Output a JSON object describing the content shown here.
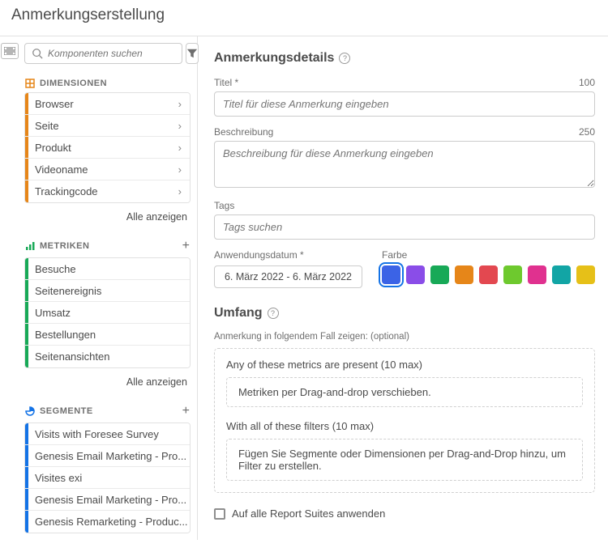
{
  "title": "Anmerkungserstellung",
  "search": {
    "placeholder": "Komponenten suchen"
  },
  "dimensions": {
    "heading": "DIMENSIONEN",
    "show_all": "Alle anzeigen",
    "items": [
      {
        "label": "Browser"
      },
      {
        "label": "Seite"
      },
      {
        "label": "Produkt"
      },
      {
        "label": "Videoname"
      },
      {
        "label": "Trackingcode"
      }
    ]
  },
  "metrics": {
    "heading": "METRIKEN",
    "show_all": "Alle anzeigen",
    "items": [
      {
        "label": "Besuche"
      },
      {
        "label": "Seitenereignis"
      },
      {
        "label": "Umsatz"
      },
      {
        "label": "Bestellungen"
      },
      {
        "label": "Seitenansichten"
      }
    ]
  },
  "segments": {
    "heading": "SEGMENTE",
    "items": [
      {
        "label": "Visits with Foresee Survey"
      },
      {
        "label": "Genesis Email Marketing - Pro..."
      },
      {
        "label": "Visites exi"
      },
      {
        "label": "Genesis Email Marketing - Pro..."
      },
      {
        "label": "Genesis Remarketing - Produc..."
      }
    ]
  },
  "details": {
    "heading": "Anmerkungsdetails",
    "title_label": "Titel *",
    "title_max": "100",
    "title_placeholder": "Titel für diese Anmerkung eingeben",
    "desc_label": "Beschreibung",
    "desc_max": "250",
    "desc_placeholder": "Beschreibung für diese Anmerkung eingeben",
    "tags_label": "Tags",
    "tags_placeholder": "Tags suchen",
    "date_label": "Anwendungsdatum *",
    "date_value": "6. März 2022 - 6. März 2022",
    "color_label": "Farbe",
    "colors": [
      "#3b63e6",
      "#8a4de8",
      "#18a957",
      "#e68619",
      "#e34850",
      "#6ec92e",
      "#e0318f",
      "#12a5a5",
      "#e6c018"
    ]
  },
  "scope": {
    "heading": "Umfang",
    "note": "Anmerkung in folgendem Fall zeigen: (optional)",
    "metrics_sub": "Any of these metrics are present (10 max)",
    "metrics_drop": "Metriken per Drag-and-drop verschieben.",
    "filters_sub": "With all of these filters (10 max)",
    "filters_drop": "Fügen Sie Segmente oder Dimensionen per Drag-and-Drop hinzu, um Filter zu erstellen."
  },
  "apply_all": "Auf alle Report Suites anwenden"
}
